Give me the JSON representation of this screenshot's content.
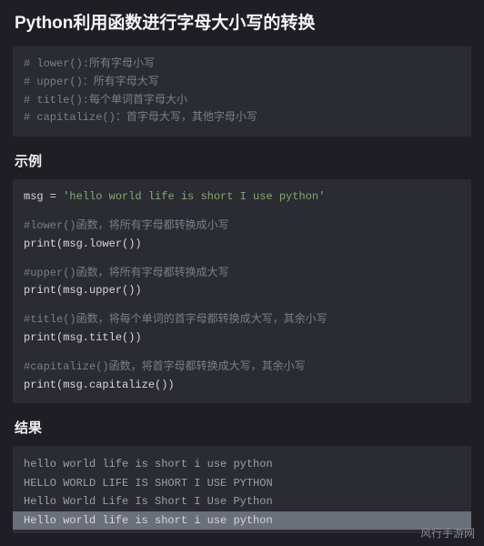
{
  "title": "Python利用函数进行字母大小写的转换",
  "intro_block": {
    "lines": [
      "# lower():所有字母小写",
      "# upper()：所有字母大写",
      "# title():每个单词首字母大小",
      "# capitalize()：首字母大写，其他字母小写"
    ]
  },
  "example_heading": "示例",
  "example_block": {
    "assign_var": "msg",
    "assign_op": " = ",
    "assign_str": "'hello world life is short I use python'",
    "sections": [
      {
        "comment": "#lower()函数，将所有字母都转换成小写",
        "call": "print(msg.lower())"
      },
      {
        "comment": "#upper()函数，将所有字母都转换成大写",
        "call": "print(msg.upper())"
      },
      {
        "comment": "#title()函数，将每个单词的首字母都转换成大写，其余小写",
        "call": "print(msg.title())"
      },
      {
        "comment": "#capitalize()函数，将首字母都转换成大写，其余小写",
        "call": "print(msg.capitalize())"
      }
    ]
  },
  "result_heading": "结果",
  "result_block": {
    "lines": [
      "hello world life is short i use python",
      "HELLO WORLD LIFE IS SHORT I USE PYTHON",
      "Hello World Life Is Short I Use Python",
      "Hello world life is short i use python"
    ],
    "highlight_index": 3
  },
  "watermark": "风行手游网"
}
